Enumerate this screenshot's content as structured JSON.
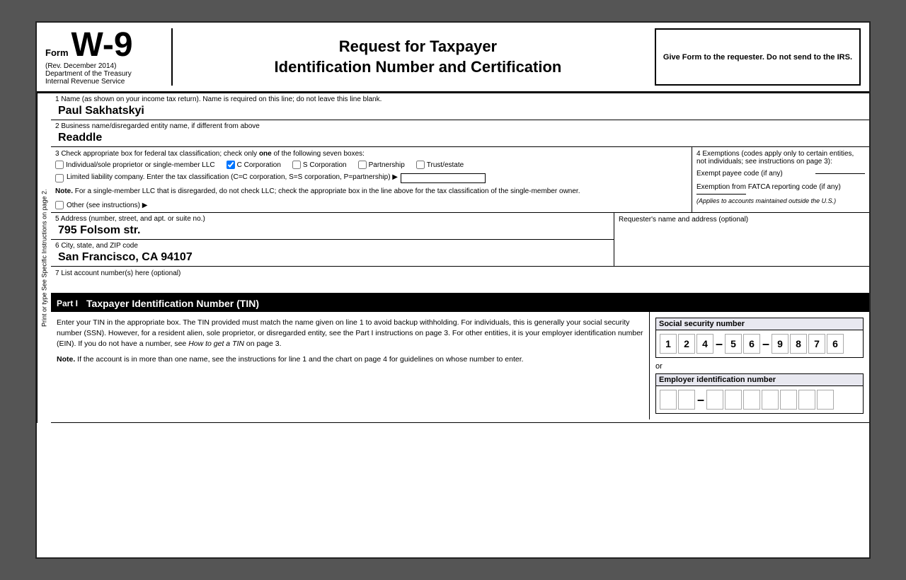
{
  "header": {
    "form_word": "Form",
    "form_number": "W-9",
    "rev": "(Rev. December 2014)",
    "dept1": "Department of the Treasury",
    "dept2": "Internal Revenue Service",
    "title_line1": "Request for Taxpayer",
    "title_line2": "Identification Number and Certification",
    "right_box": "Give Form to the requester. Do not send to the IRS."
  },
  "fields": {
    "field1_label": "1  Name (as shown on your income tax return). Name is required on this line; do not leave this line blank.",
    "field1_value": "Paul Sakhatskyi",
    "field2_label": "2  Business name/disregarded entity name, if different from above",
    "field2_value": "Readdle",
    "field3_label": "3  Check appropriate box for federal tax classification; check only",
    "field3_label_bold": "one",
    "field3_label2": "of the following seven boxes:",
    "checkbox_individual_label": "Individual/sole proprietor or single-member LLC",
    "checkbox_individual_checked": false,
    "checkbox_ccorp_label": "C Corporation",
    "checkbox_ccorp_checked": true,
    "checkbox_scorp_label": "S Corporation",
    "checkbox_scorp_checked": false,
    "checkbox_partnership_label": "Partnership",
    "checkbox_partnership_checked": false,
    "checkbox_trust_label": "Trust/estate",
    "checkbox_trust_checked": false,
    "llc_text": "Limited liability company. Enter the tax classification (C=C corporation, S=S corporation, P=partnership) ▶",
    "llc_checked": false,
    "note_text": "Note.",
    "note_content": " For a single-member LLC that is disregarded, do not check LLC; check the appropriate box in the line above for the tax classification of the single-member owner.",
    "other_label": "Other (see instructions) ▶",
    "other_checked": false,
    "field4_label": "4  Exemptions (codes apply only to certain entities, not individuals; see instructions on page 3):",
    "exempt_payee_label": "Exempt payee code (if any)",
    "fatca_label": "Exemption from FATCA reporting code (if any)",
    "fatca_note": "(Applies to accounts maintained outside the U.S.)",
    "field5_label": "5  Address (number, street, and apt. or suite no.)",
    "field5_value": "795 Folsom str.",
    "field6_label": "6  City, state, and ZIP code",
    "field6_value": "San Francisco, CA 94107",
    "requester_label": "Requester's name and address (optional)",
    "field7_label": "7  List account number(s) here (optional)",
    "sidebar_text": "Print or type          See Specific Instructions on page 2."
  },
  "part1": {
    "label": "Part I",
    "title": "Taxpayer Identification Number (TIN)",
    "instructions": "Enter your TIN in the appropriate box. The TIN provided must match the name given on line 1 to avoid backup withholding. For individuals, this is generally your social security number (SSN). However, for a resident alien, sole proprietor, or disregarded entity, see the Part I instructions on page 3. For other entities, it is your employer identification number (EIN). If you do not have a number, see",
    "instructions_italic": " How to get a TIN",
    "instructions_end": " on page 3.",
    "note_label": "Note.",
    "note_text": " If the account is in more than one name, see the instructions for line 1 and the chart on page 4 for guidelines on whose number to enter.",
    "ssn_label": "Social security number",
    "ssn_digits": [
      "1",
      "2",
      "4",
      "",
      "5",
      "6",
      "",
      "9",
      "8",
      "7",
      "6"
    ],
    "ssn_format": "###-##-####",
    "or_text": "or",
    "ein_label": "Employer identification number",
    "ein_digits": [
      "",
      "",
      "",
      "",
      "",
      "",
      "",
      "",
      ""
    ]
  }
}
